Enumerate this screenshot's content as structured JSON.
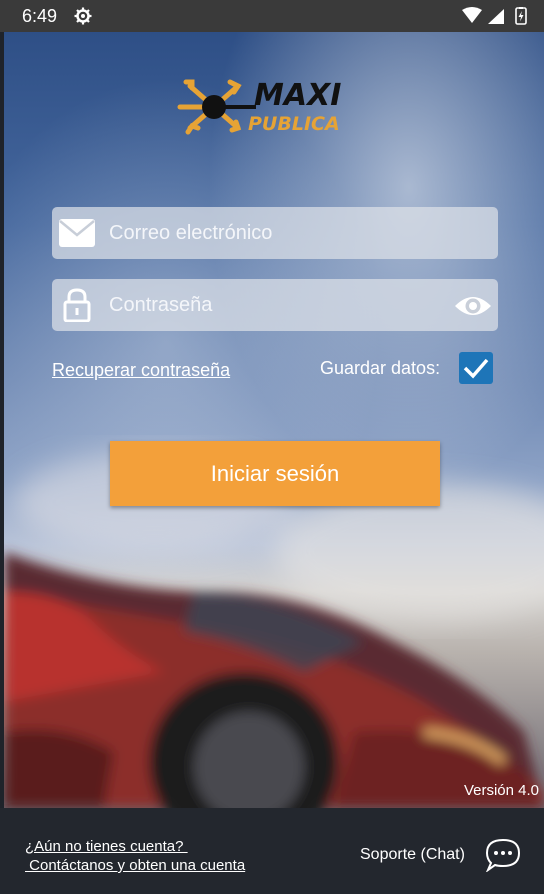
{
  "status": {
    "time": "6:49"
  },
  "login": {
    "email_placeholder": "Correo electrónico",
    "password_placeholder": "Contraseña",
    "recover_link": "Recuperar contraseña",
    "save_label": "Guardar datos:",
    "save_checked": true,
    "button_label": "Iniciar sesión"
  },
  "version": "Versión 4.0",
  "footer": {
    "account_line1": "¿Aún no tienes cuenta? ",
    "account_line2": " Contáctanos y obten una cuenta",
    "support_label": "Soporte (Chat)"
  },
  "colors": {
    "accent": "#f3a03a",
    "checkbox": "#1e75b8",
    "footer": "#23272e"
  },
  "icons": [
    "gear-icon",
    "wifi-icon",
    "signal-icon",
    "battery-icon",
    "email-icon",
    "lock-icon",
    "eye-icon",
    "check-icon",
    "chat-icon"
  ]
}
